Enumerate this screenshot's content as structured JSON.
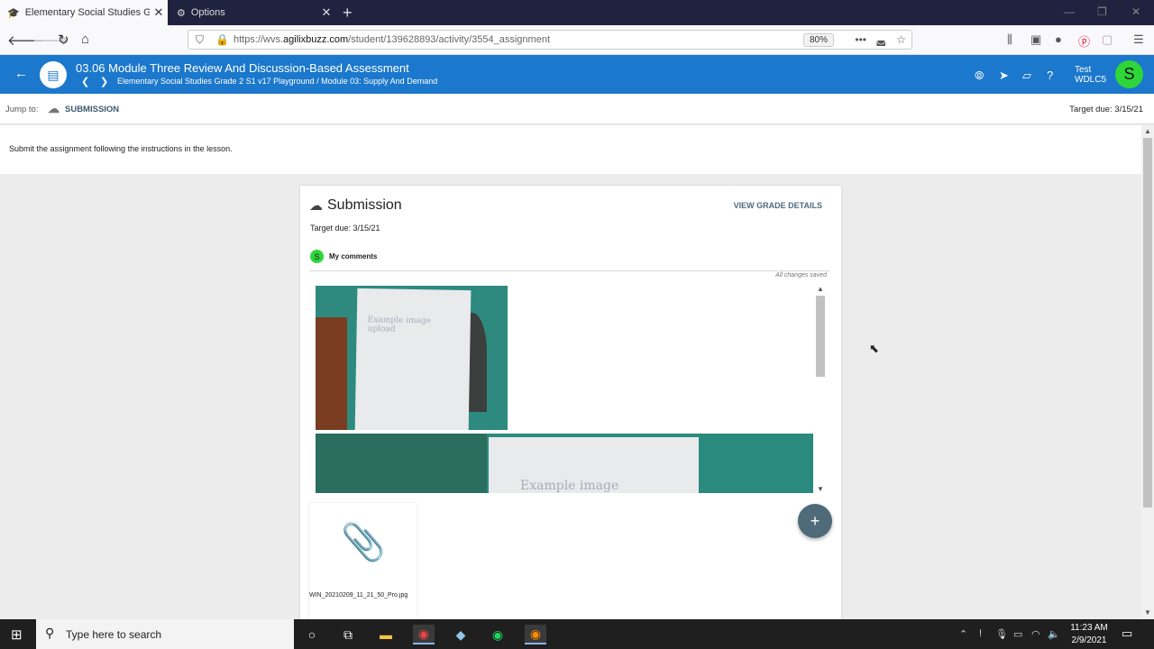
{
  "browser": {
    "tabs": [
      {
        "title": "Elementary Social Studies Grac",
        "icon": "buzz-icon"
      },
      {
        "title": "Options",
        "icon": "gear-icon"
      }
    ],
    "url_prefix": "https://wvs.",
    "url_domain": "agilixbuzz.com",
    "url_path": "/student/139628893/activity/3554_assignment",
    "zoom": "80%"
  },
  "app": {
    "title": "03.06 Module Three Review And Discussion-Based Assessment",
    "breadcrumb": "Elementary Social Studies Grade 2 S1 v17 Playground / Module 03: Supply And Demand",
    "user_line1": "Test",
    "user_line2": "WDLC5",
    "avatar_letter": "S",
    "accent": "#1b78cc",
    "avatar_color": "#2ed63a"
  },
  "jumpbar": {
    "label": "Jump to:",
    "link": "SUBMISSION",
    "target_due": "Target due: 3/15/21"
  },
  "instructions": "Submit the assignment following the instructions in the lesson.",
  "submission": {
    "title": "Submission",
    "grade_link": "VIEW GRADE DETAILS",
    "target_due": "Target due: 3/15/21",
    "comments_avatar": "S",
    "comments_label": "My comments",
    "saved_status": "All changes saved",
    "attachment_name": "WIN_20210209_11_21_50_Pro.jpg",
    "fab_label": "+"
  },
  "taskbar": {
    "search_placeholder": "Type here to search",
    "time": "11:23 AM",
    "date": "2/9/2021"
  }
}
